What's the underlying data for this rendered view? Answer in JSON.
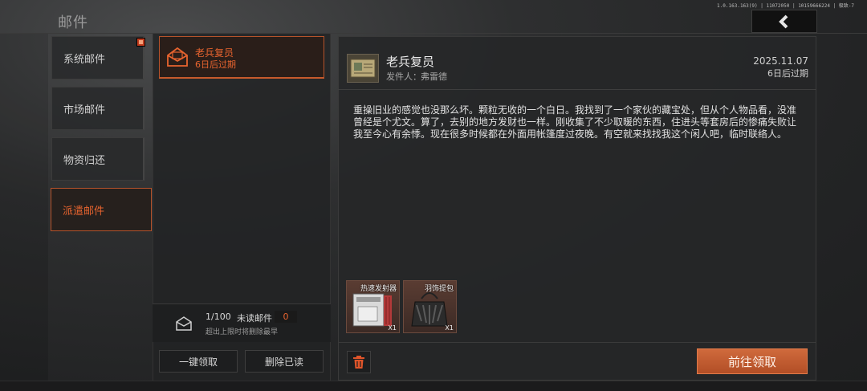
{
  "header": {
    "title": "邮件",
    "version": "1.0.163.163(9) | 11072050 | 10159666224 | 极致-7"
  },
  "categories": [
    {
      "label": "系统邮件",
      "has_badge": true
    },
    {
      "label": "市场邮件",
      "has_badge": false
    },
    {
      "label": "物资归还",
      "has_badge": false
    },
    {
      "label": "派遣邮件",
      "has_badge": false,
      "active": true
    }
  ],
  "mail_list": {
    "items": [
      {
        "title": "老兵复员",
        "expire": "6日后过期",
        "icon": "envelope-icon"
      }
    ],
    "count": "1/100",
    "unread_label": "未读邮件",
    "unread_count": "0",
    "note": "超出上限时将删除最早",
    "claim_all_label": "一键领取",
    "delete_read_label": "删除已读"
  },
  "detail": {
    "title": "老兵复员",
    "sender_label": "发件人：",
    "sender_name": "弗雷德",
    "date": "2025.11.07",
    "expire": "6日后过期",
    "body": "重操旧业的感觉也没那么坏。颗粒无收的一个白日。我找到了一个家伙的藏宝处，但从个人物品看，没准曾经是个尤文。算了，去别的地方发财也一样。刚收集了不少取暖的东西，住进头等套房后的惨痛失败让我至今心有余悸。现在很多时候都在外面用帐篷度过夜晚。有空就来找找我这个闲人吧，临时联络人。",
    "attachments": [
      {
        "name": "热速发射器",
        "qty": "X1",
        "icon": "heater-icon"
      },
      {
        "name": "羽饰提包",
        "qty": "X1",
        "icon": "feather-bag-icon"
      }
    ],
    "claim_label": "前往领取"
  },
  "colors": {
    "accent": "#e8642f",
    "claim_button": "#c05a2e",
    "badge": "#c23c1e"
  }
}
